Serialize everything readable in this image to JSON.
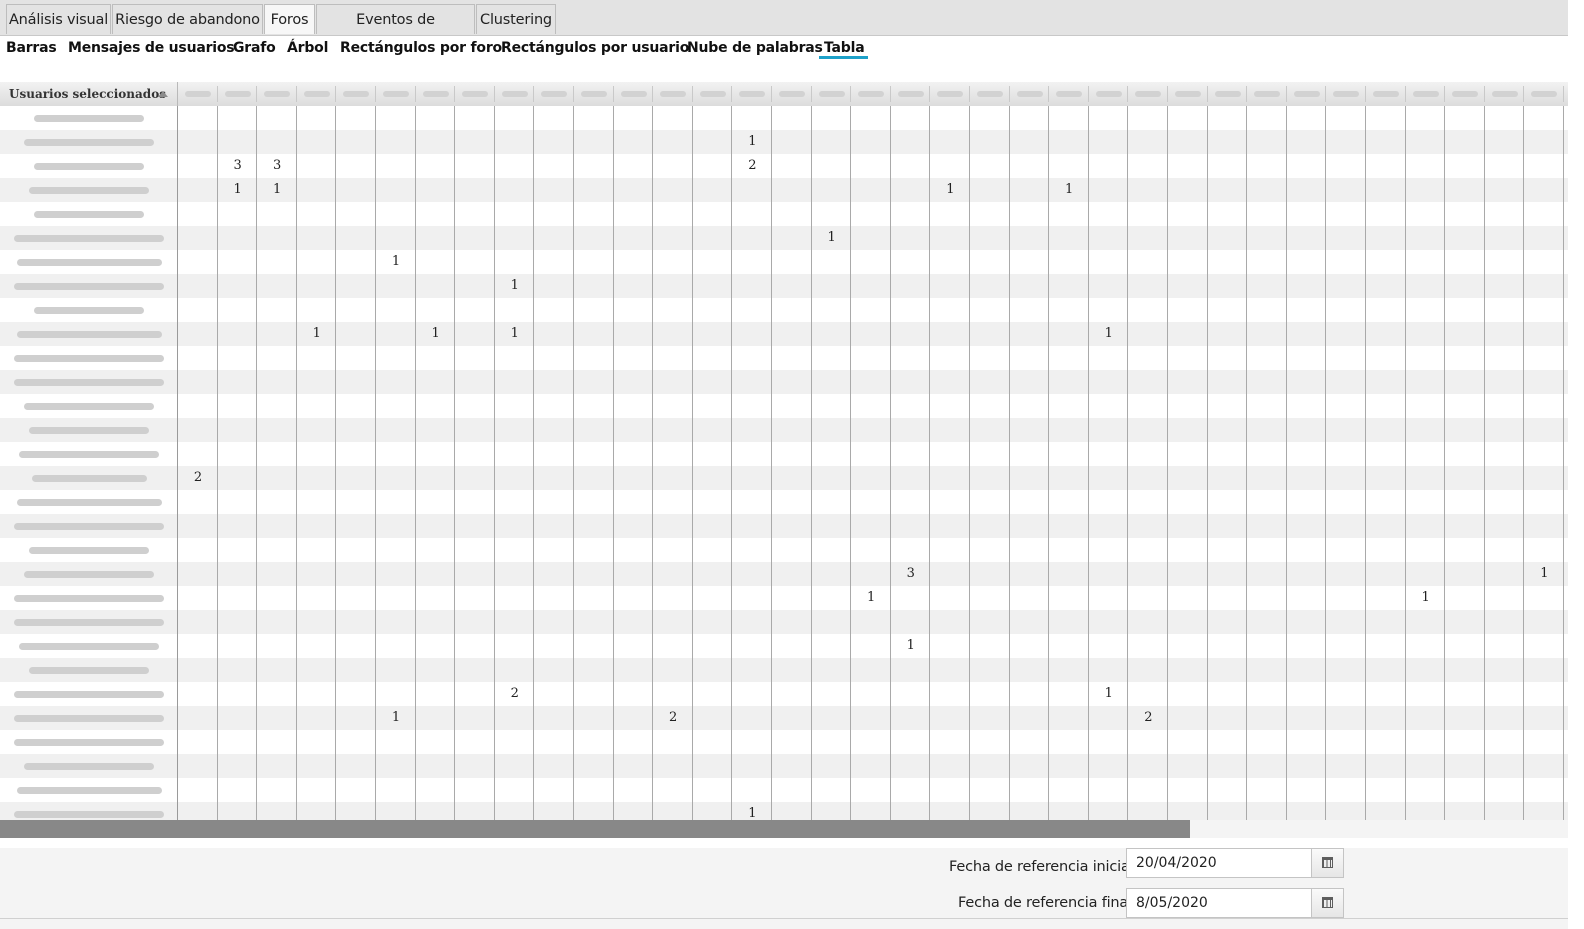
{
  "tabs": [
    {
      "label": "Análisis visual"
    },
    {
      "label": "Riesgo de abandono"
    },
    {
      "label": "Foros"
    },
    {
      "label": "Eventos de calendario"
    },
    {
      "label": "Clustering"
    }
  ],
  "active_tab": "Foros",
  "subtabs": [
    {
      "label": "Barras"
    },
    {
      "label": "Mensajes de usuarios"
    },
    {
      "label": "Grafo"
    },
    {
      "label": "Árbol"
    },
    {
      "label": "Rectángulos por foro"
    },
    {
      "label": "Rectángulos por usuario"
    },
    {
      "label": "Nube de palabras"
    },
    {
      "label": "Tabla"
    }
  ],
  "active_subtab": "Tabla",
  "table": {
    "first_column_header": "Usuarios seleccionados",
    "sort_icon": "sort-ascending-icon",
    "column_count": 35,
    "row_count": 30,
    "cells": [
      {
        "row": 1,
        "col": 15,
        "value": "1"
      },
      {
        "row": 2,
        "col": 2,
        "value": "3"
      },
      {
        "row": 2,
        "col": 3,
        "value": "3"
      },
      {
        "row": 2,
        "col": 15,
        "value": "2"
      },
      {
        "row": 3,
        "col": 2,
        "value": "1"
      },
      {
        "row": 3,
        "col": 3,
        "value": "1"
      },
      {
        "row": 3,
        "col": 20,
        "value": "1"
      },
      {
        "row": 3,
        "col": 23,
        "value": "1"
      },
      {
        "row": 5,
        "col": 17,
        "value": "1"
      },
      {
        "row": 6,
        "col": 6,
        "value": "1"
      },
      {
        "row": 7,
        "col": 9,
        "value": "1"
      },
      {
        "row": 9,
        "col": 4,
        "value": "1"
      },
      {
        "row": 9,
        "col": 7,
        "value": "1"
      },
      {
        "row": 9,
        "col": 9,
        "value": "1"
      },
      {
        "row": 9,
        "col": 24,
        "value": "1"
      },
      {
        "row": 15,
        "col": 1,
        "value": "2"
      },
      {
        "row": 19,
        "col": 19,
        "value": "3"
      },
      {
        "row": 19,
        "col": 35,
        "value": "1"
      },
      {
        "row": 20,
        "col": 18,
        "value": "1"
      },
      {
        "row": 20,
        "col": 32,
        "value": "1"
      },
      {
        "row": 22,
        "col": 19,
        "value": "1"
      },
      {
        "row": 24,
        "col": 9,
        "value": "2"
      },
      {
        "row": 24,
        "col": 24,
        "value": "1"
      },
      {
        "row": 25,
        "col": 6,
        "value": "1"
      },
      {
        "row": 25,
        "col": 13,
        "value": "2"
      },
      {
        "row": 25,
        "col": 25,
        "value": "2"
      },
      {
        "row": 29,
        "col": 15,
        "value": "1"
      }
    ]
  },
  "dates": {
    "start_label": "Fecha de referencia inicial:",
    "start_value": "20/04/2020",
    "end_label": "Fecha de referencia final:",
    "end_value": "8/05/2020",
    "picker_icon": "calendar-icon"
  }
}
